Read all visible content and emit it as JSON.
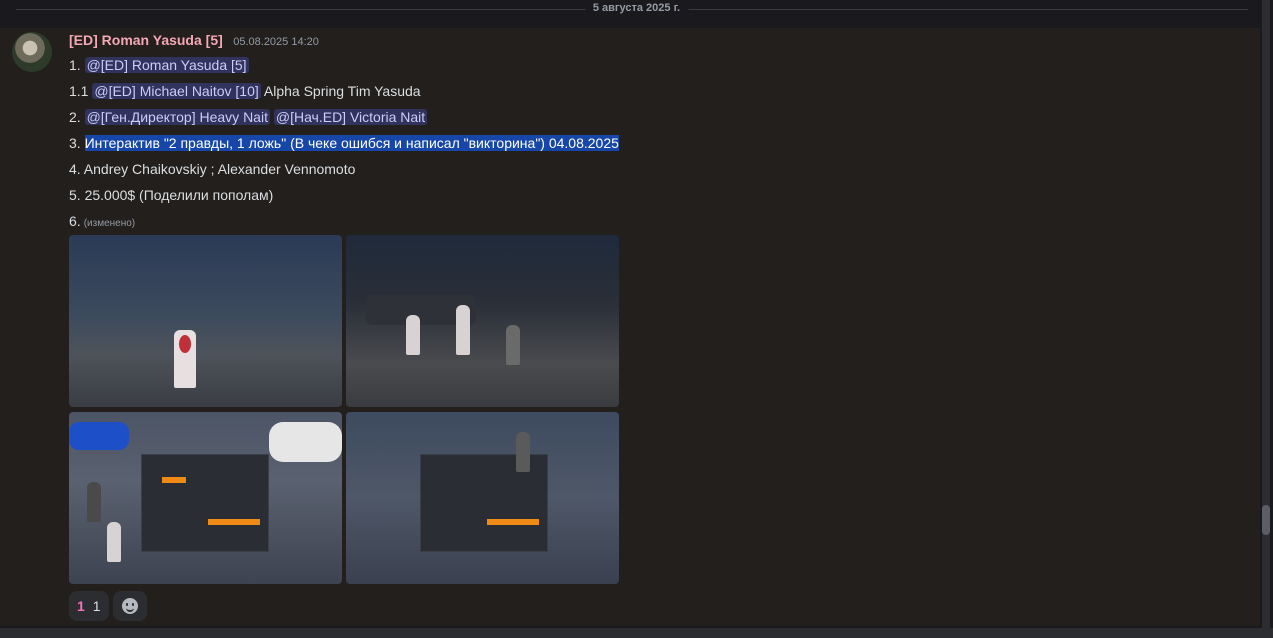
{
  "date_divider": "5 августа 2025 г.",
  "message": {
    "author": "[ED] Roman Yasuda [5]",
    "timestamp": "05.08.2025 14:20",
    "lines": {
      "l1_prefix": "1.",
      "l1_mention": "@[ED] Roman Yasuda [5]",
      "l11_prefix": "1.1",
      "l11_mention": "@[ED] Michael Naitov [10]",
      "l11_text": "Alpha Spring Tim Yasuda",
      "l2_prefix": "2.",
      "l2_mention1": "@[Ген.Директор] Heavy Nait",
      "l2_mention2": "@[Нач.ED] Victoria Nait",
      "l3_prefix": "3.",
      "l3_text": "Интерактив \"2 правды, 1 ложь\" (В чеке ошибся и написал \"викторина\") 04.08.2025",
      "l4_text": "4. Andrey Chaikovskiy ; Alexander Vennomoto",
      "l5_text": "5. 25.000$ (Поделили пополам)",
      "l6_prefix": "6.",
      "edited": "(изменено)"
    },
    "reactions": [
      {
        "emoji": "1",
        "count": "1"
      }
    ]
  },
  "colors": {
    "username": "#f4a8b4",
    "mention_bg": "#4a5294",
    "selection_bg": "#1546a8"
  }
}
